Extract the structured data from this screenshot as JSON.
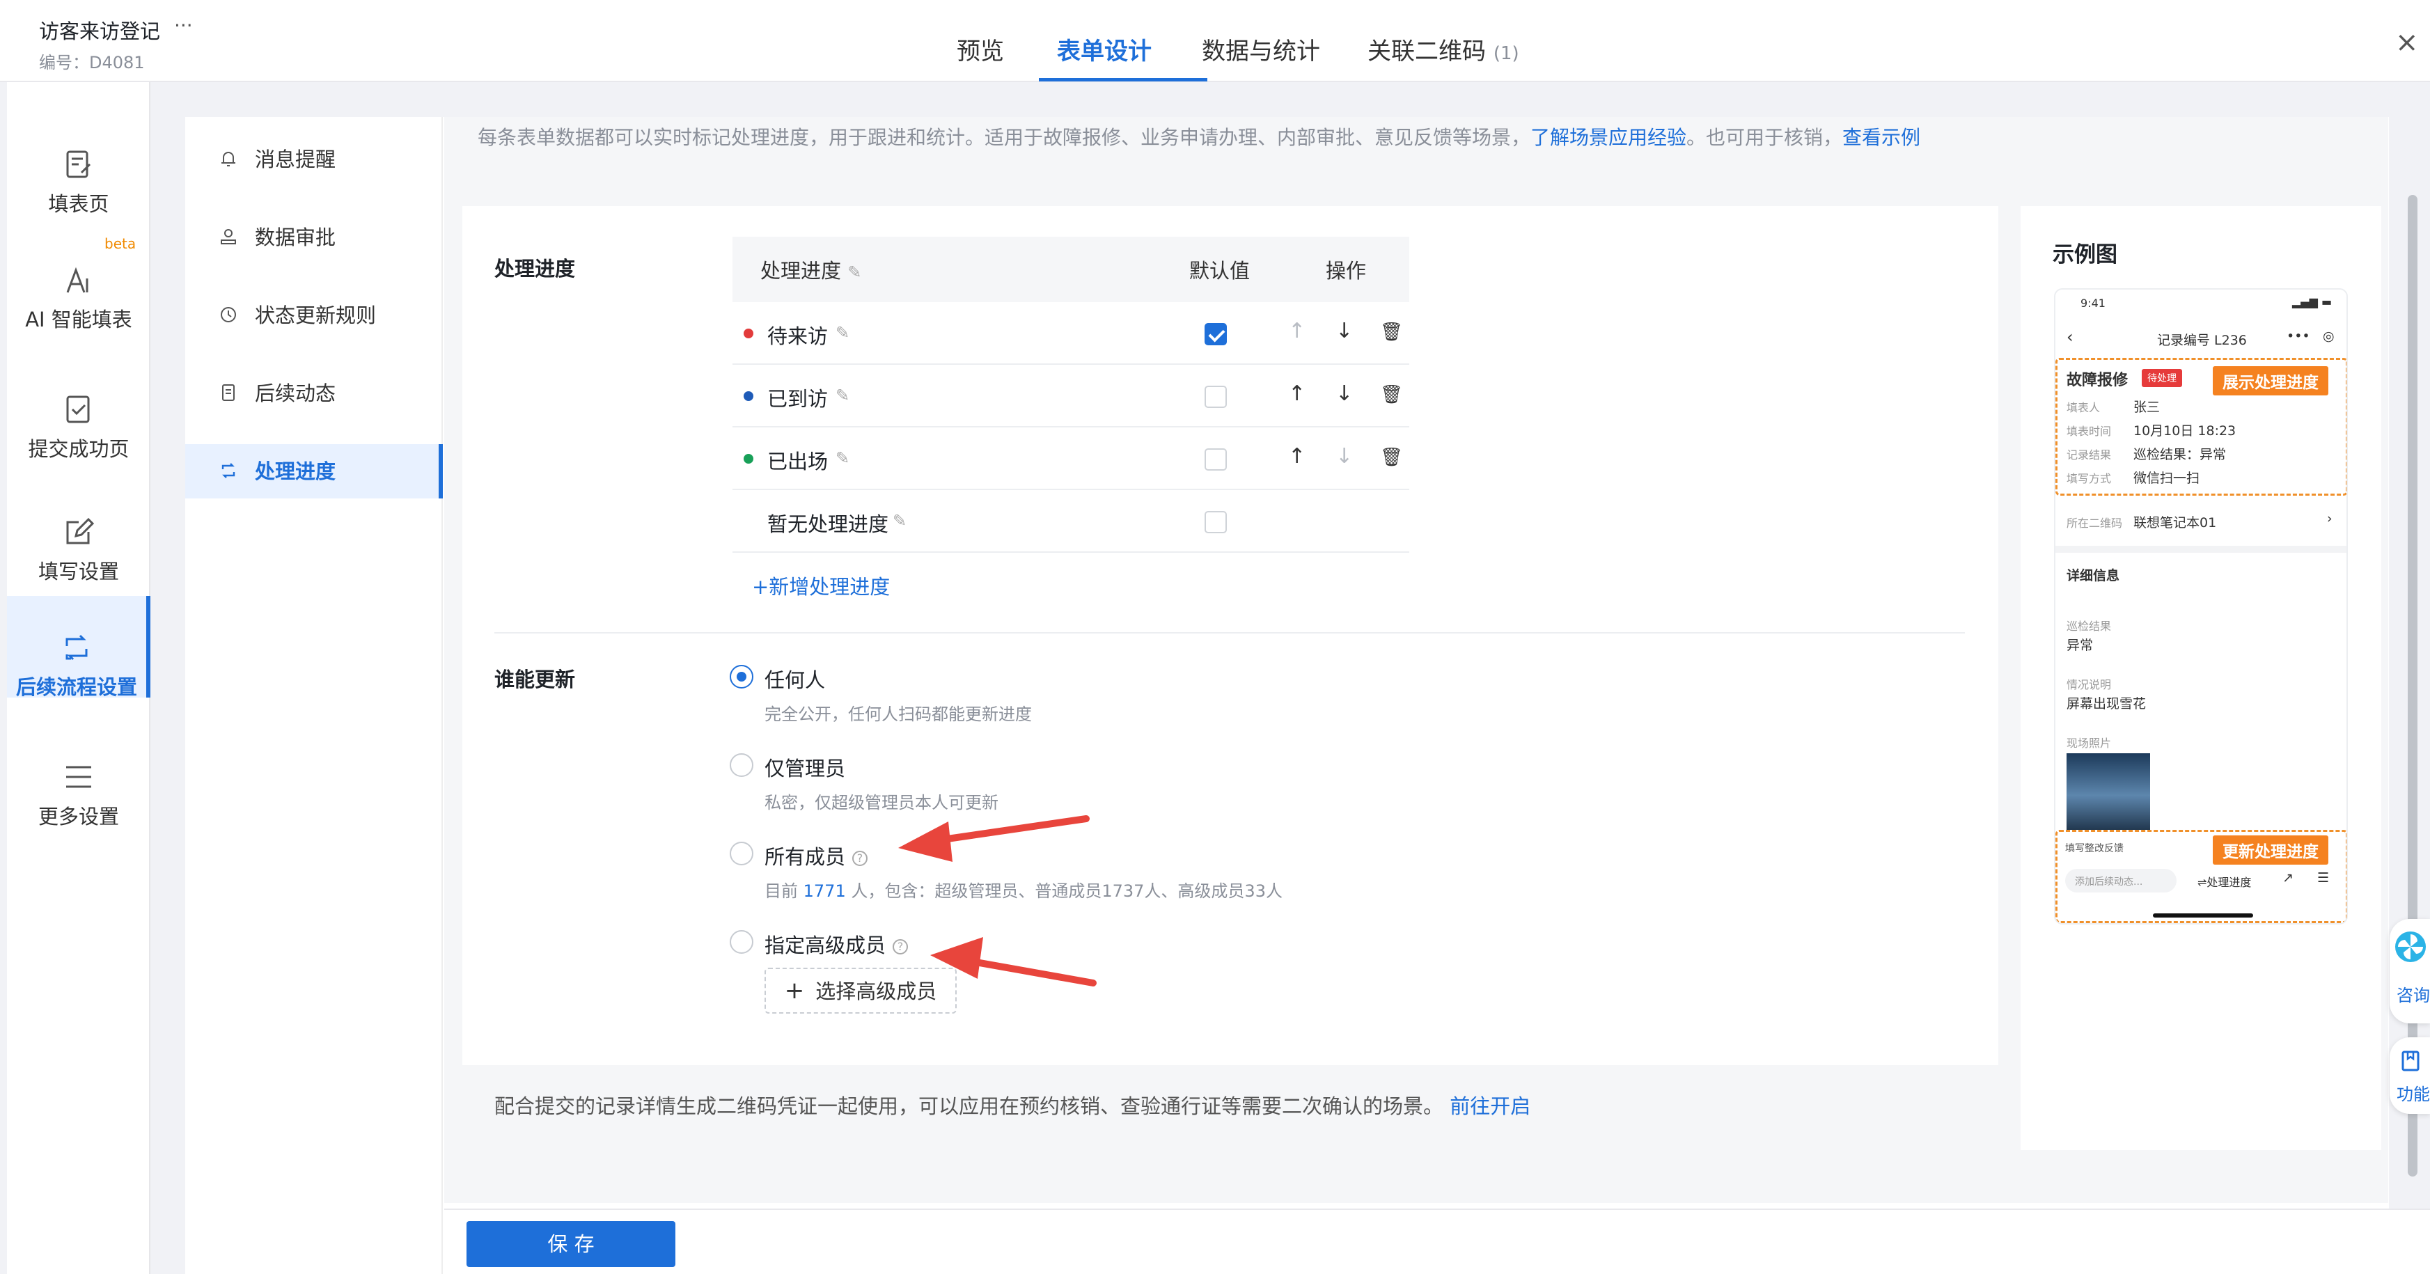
{
  "app": {
    "title": "访客来访登记",
    "more": "···",
    "code": "编号：D4081",
    "close": "×"
  },
  "tabs": [
    {
      "label": "预览"
    },
    {
      "label": "表单设计"
    },
    {
      "label": "数据与统计"
    },
    {
      "label": "关联二维码",
      "count": "(1)"
    }
  ],
  "leftnav": [
    {
      "label": "填表页",
      "icon": "form-edit-icon"
    },
    {
      "label": "AI 智能填表",
      "icon": "ai-fill-icon",
      "badge": "beta"
    },
    {
      "label": "提交成功页",
      "icon": "submit-success-icon"
    },
    {
      "label": "填写设置",
      "icon": "fill-settings-icon"
    },
    {
      "label": "后续流程设置",
      "icon": "workflow-icon"
    },
    {
      "label": "更多设置",
      "icon": "menu-icon"
    }
  ],
  "subnav": [
    {
      "label": "消息提醒",
      "icon": "bell-icon"
    },
    {
      "label": "数据审批",
      "icon": "approval-icon"
    },
    {
      "label": "状态更新规则",
      "icon": "clock-icon"
    },
    {
      "label": "后续动态",
      "icon": "document-icon"
    },
    {
      "label": "处理进度",
      "icon": "sync-icon"
    }
  ],
  "tip": {
    "text": "每条表单数据都可以实时标记处理进度，用于跟进和统计。适用于故障报修、业务申请办理、内部审批、意见反馈等场景，",
    "link1": "了解场景应用经验",
    "mid": "。也可用于核销，",
    "link2": "查看示例"
  },
  "progress": {
    "section_title": "处理进度",
    "headers": {
      "name": "处理进度",
      "default": "默认值",
      "ops": "操作"
    },
    "rows": [
      {
        "name": "待来访",
        "color": "#e23b3b",
        "default": true
      },
      {
        "name": "已到访",
        "color": "#1e5bb8",
        "default": false
      },
      {
        "name": "已出场",
        "color": "#18a058",
        "default": false
      },
      {
        "name": "暂无处理进度",
        "color": "",
        "default": false
      }
    ],
    "add_label": "+新增处理进度"
  },
  "who": {
    "section_title": "谁能更新",
    "options": [
      {
        "label": "任何人",
        "desc": "完全公开，任何人扫码都能更新进度",
        "selected": true
      },
      {
        "label": "仅管理员",
        "desc": "私密，仅超级管理员本人可更新",
        "selected": false
      },
      {
        "label": "所有成员",
        "desc_pre": "目前 ",
        "desc_num": "1771",
        "desc_post": " 人，包含：超级管理员、普通成员1737人、高级成员33人",
        "selected": false
      },
      {
        "label": "指定高级成员",
        "selected": false
      }
    ],
    "select_btn": "选择高级成员",
    "plus": "+"
  },
  "qr_note": {
    "text": "配合提交的记录详情生成二维码凭证一起使用，可以应用在预约核销、查验通行证等需要二次确认的场景。",
    "link": "前往开启"
  },
  "save": "保 存",
  "example": {
    "title": "示例图",
    "time": "9:41",
    "record": "记录编号 L236",
    "card_title": "故障报修",
    "status_tag": "待处理",
    "show_btn": "展示处理进度",
    "fields": [
      {
        "k": "填表人",
        "v": "张三"
      },
      {
        "k": "填表时间",
        "v": "10月10日 18:23"
      },
      {
        "k": "记录结果",
        "v": "巡检结果：异常"
      },
      {
        "k": "填写方式",
        "v": "微信扫一扫"
      }
    ],
    "qrcode_k": "所在二维码",
    "qrcode_v": "联想笔记本01",
    "detail": "详细信息",
    "d1k": "巡检结果",
    "d1v": "异常",
    "d2k": "情况说明",
    "d2v": "屏幕出现雪花",
    "d3k": "现场照片",
    "update_btn": "更新处理进度",
    "bottom_hint": "填写整改反馈",
    "bottom_input": "添加后续动态...",
    "bottom_progress": "⇌处理进度"
  },
  "float": {
    "consult": "咨询",
    "func": "功能"
  }
}
